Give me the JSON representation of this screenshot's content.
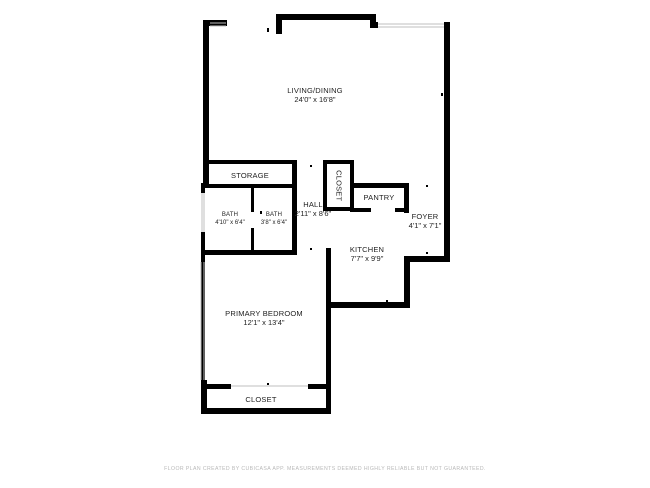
{
  "rooms": {
    "living_dining": {
      "name": "LIVING/DINING",
      "dims": "24'0\" x 16'8\""
    },
    "storage": {
      "name": "STORAGE"
    },
    "bath1": {
      "name": "BATH",
      "dims": "4'10\" x 6'4\""
    },
    "bath2": {
      "name": "BATH",
      "dims": "3'8\" x 6'4\""
    },
    "hall": {
      "name": "HALL",
      "dims": "2'11\" x 8'6\""
    },
    "closet_hall": {
      "name": "CLOSET"
    },
    "pantry": {
      "name": "PANTRY"
    },
    "foyer": {
      "name": "FOYER",
      "dims": "4'1\" x 7'1\""
    },
    "kitchen": {
      "name": "KITCHEN",
      "dims": "7'7\" x 9'9\""
    },
    "primary_bedroom": {
      "name": "PRIMARY BEDROOM",
      "dims": "12'1\" x 13'4\""
    },
    "closet_bedroom": {
      "name": "CLOSET"
    }
  },
  "footer": "FLOOR PLAN CREATED BY CUBICASA APP. MEASUREMENTS DEEMED HIGHLY RELIABLE BUT NOT GUARANTEED.",
  "colors": {
    "wall": "#000000",
    "window": "#bfbfbf",
    "background": "#ffffff"
  }
}
